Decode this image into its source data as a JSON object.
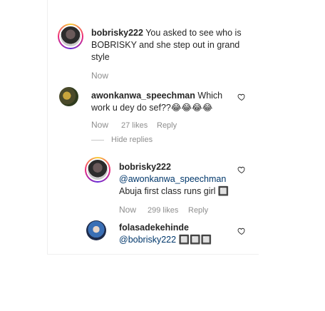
{
  "comments": [
    {
      "username": "bobrisky222",
      "text": "You asked to see who is BOBRISKY and she step out in grand style",
      "time": "Now"
    },
    {
      "username": "awonkanwa_speechman",
      "text": "Which work u dey do sef??",
      "emojis": "😂😂😂😂",
      "time": "Now",
      "likes": "27 likes",
      "reply_label": "Reply",
      "toggle_replies": "Hide replies"
    }
  ],
  "replies": [
    {
      "username": "bobrisky222",
      "mention": "@awonkanwa_speechman",
      "text": "Abuja first class runs girl 🔲",
      "time": "Now",
      "likes": "299 likes",
      "reply_label": "Reply"
    },
    {
      "username": "folasadekehinde",
      "mention": "@bobrisky222",
      "text": "🔲🔲🔲"
    }
  ],
  "colors": {
    "text": "#262626",
    "muted": "#8e8e8e",
    "link": "#00376b"
  },
  "icons": [
    "heart-icon"
  ]
}
